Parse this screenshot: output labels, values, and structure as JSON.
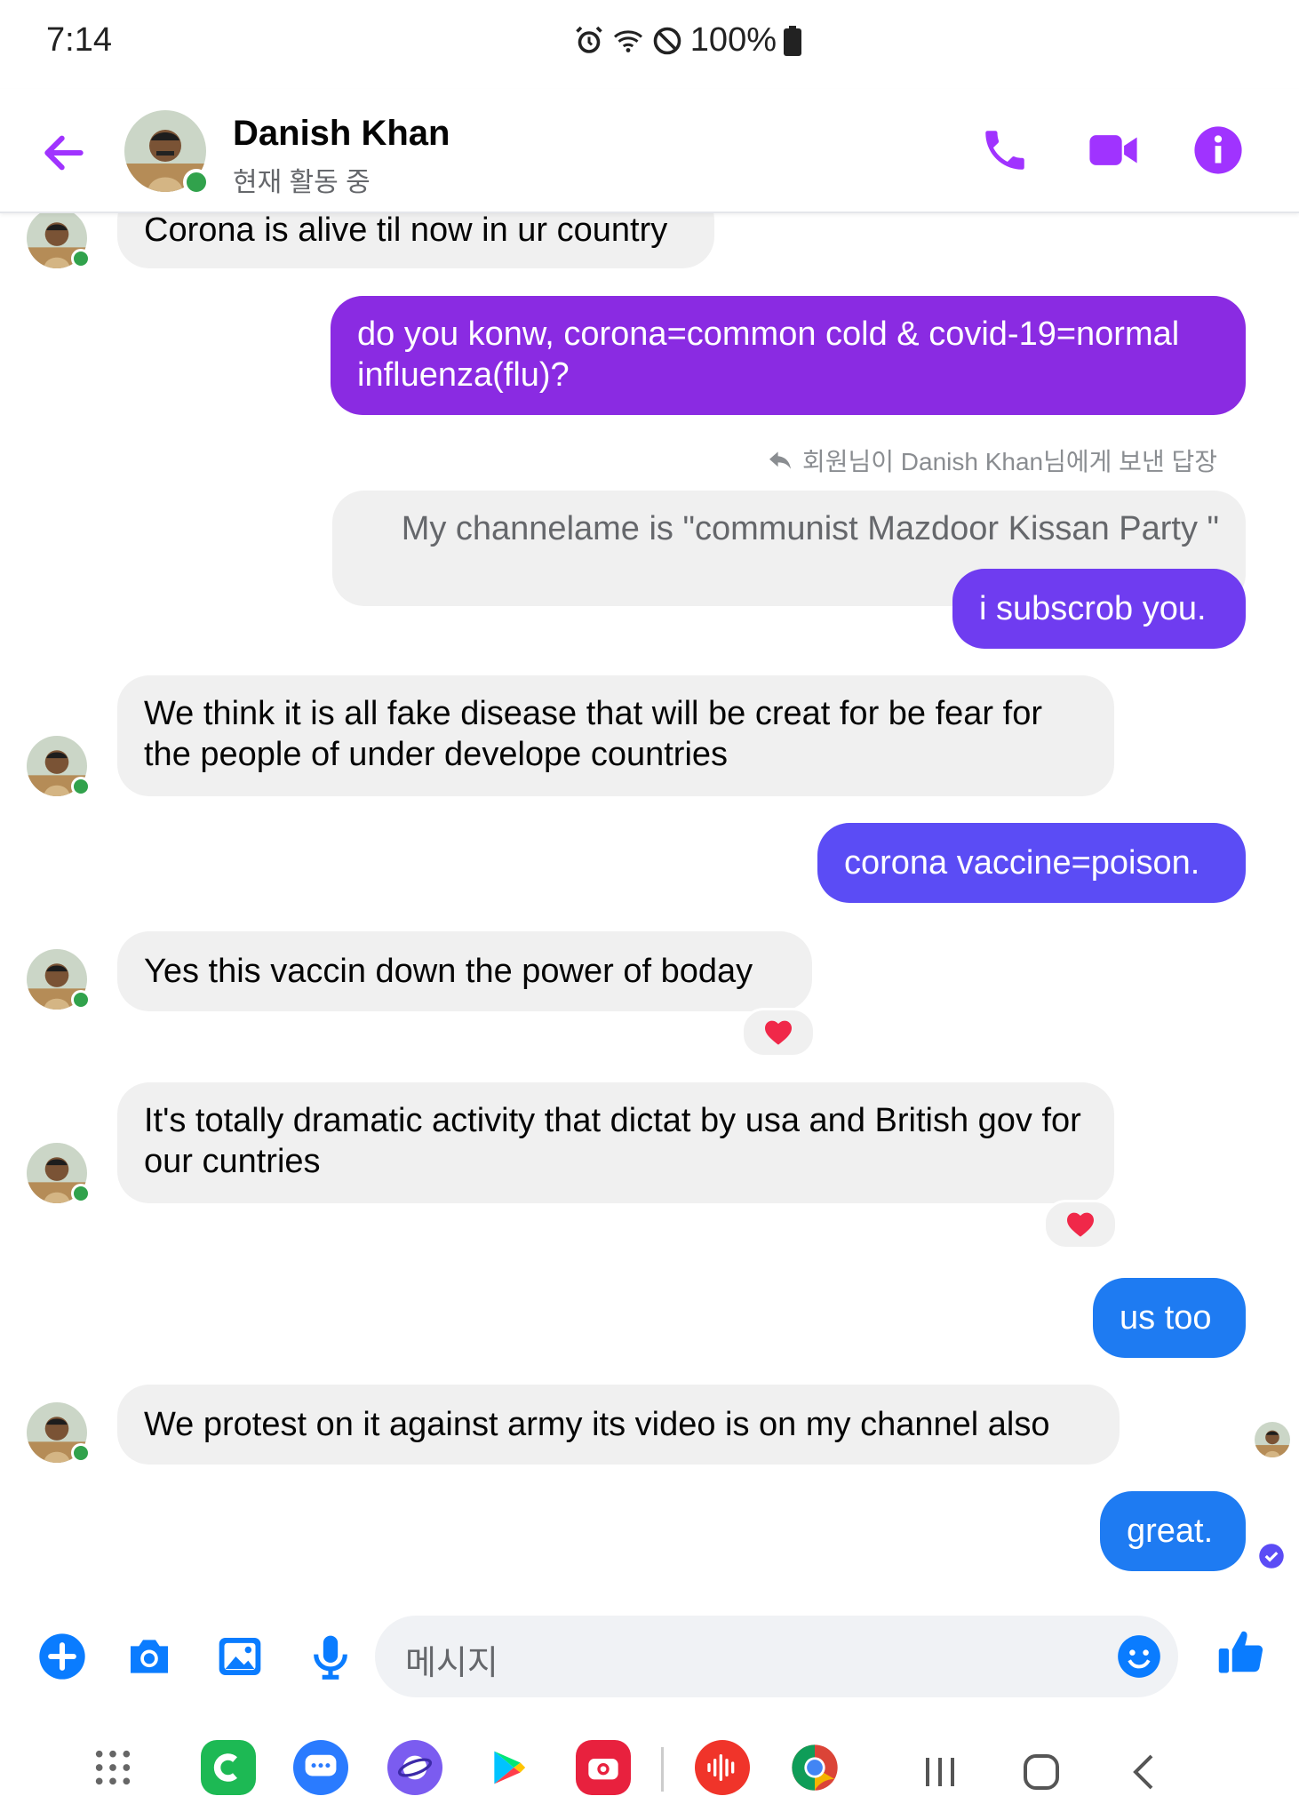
{
  "status_bar": {
    "time": "7:14",
    "battery": "100%"
  },
  "header": {
    "contact_name": "Danish Khan",
    "contact_status": "현재 활동 중"
  },
  "messages": [
    {
      "from": "them",
      "text": "Corona is alive til now in ur country"
    },
    {
      "from": "me",
      "text": "do you konw, corona=common cold & covid-19=normal influenza(flu)?"
    },
    {
      "from": "me",
      "reply_note": "회원님이 Danish Khan님에게 보낸 답장",
      "quoted": "My channelame is \"communist Mazdoor Kissan Party \"",
      "text": "i subscrob you."
    },
    {
      "from": "them",
      "text": "We think it is all fake disease that will be creat for be fear for the people of under develope countries"
    },
    {
      "from": "me",
      "text": "corona vaccine=poison."
    },
    {
      "from": "them",
      "text": "Yes this vaccin down the power of boday",
      "reaction": "heart"
    },
    {
      "from": "them",
      "text": "It's totally dramatic activity that dictat by usa and British gov for our cuntries",
      "reaction": "heart"
    },
    {
      "from": "me",
      "text": "us too"
    },
    {
      "from": "them",
      "text": "We protest on it against army its video is on my channel also"
    },
    {
      "from": "me",
      "text": "great."
    }
  ],
  "composer": {
    "placeholder": "메시지"
  },
  "colors": {
    "accent_purple": "#a033ff",
    "bubble_purple": "#8a2be2",
    "bubble_indigo": "#5b4cf5",
    "bubble_blue": "#1e7bf2",
    "composer_blue": "#0a7cff",
    "online_green": "#31a24c"
  }
}
